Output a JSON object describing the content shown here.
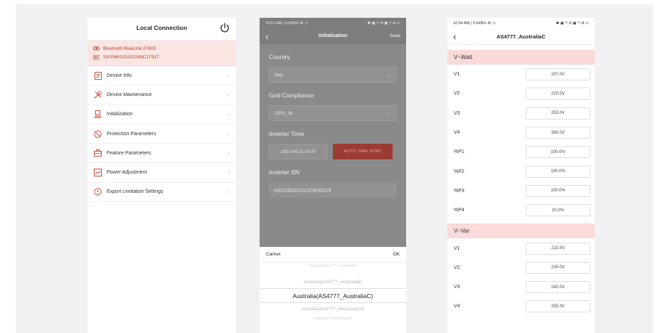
{
  "panel1": {
    "title": "Local Connection",
    "bluetooth": "Bluetooth:BlueLink:27805",
    "sn": "SN:R6K2153J2248C17917",
    "menu": [
      {
        "label": "Device Info",
        "icon": "device-info-icon"
      },
      {
        "label": "Device Maintenance",
        "icon": "maintenance-icon"
      },
      {
        "label": "Initialization",
        "icon": "initialization-icon"
      },
      {
        "label": "Protection Parameters",
        "icon": "protection-icon"
      },
      {
        "label": "Feature Parameters",
        "icon": "feature-icon"
      },
      {
        "label": "Power Adjustment",
        "icon": "power-adjust-icon"
      },
      {
        "label": "Export Limitation Settings",
        "icon": "export-limit-icon"
      }
    ]
  },
  "panel2": {
    "status_left": "10:51 AM | 0.0KB/s ⚙ ☺",
    "status_right": "✱ ▣ ᵛᵒ.ıll ▣ ᵛᵒ.ıll ▭",
    "title": "Initialization",
    "save": "Save",
    "country_label": "Country",
    "country_value": "Italy",
    "grid_label": "Grid Compliance",
    "grid_value": "CEI0_16",
    "time_label": "Inverter Time",
    "time_value": "2023-04-21 10:47",
    "sync_label": "AUTO TIME SYNC",
    "sn_label": "Inverter SN",
    "sn_value": "HSS2602G2237E00019",
    "cancel": "Cancel",
    "ok": "OK",
    "picker": {
      "top_faint": "Australia(AS4777_AustraliaA)",
      "above": "Australia(AS4777_AustraliaB)",
      "selected": "Australia(AS4777_AustraliaC)",
      "below": "Australia(AS4777_NewZealand)",
      "bottom_faint": "Australia(TOR Erzeuger)"
    }
  },
  "panel3": {
    "status_left": "10:54 AM | 0.5KB/s ⚙ ☺",
    "status_right": "✱ ▣ ᵛᵒ.ıll ▣ ᵛᵒ.ıll ▭",
    "title": "AS4777_AustraliaC",
    "sections": [
      {
        "name": "V~Watt",
        "rows": [
          {
            "label": "V1",
            "value": "207.0V"
          },
          {
            "label": "V2",
            "value": "220.0V"
          },
          {
            "label": "V3",
            "value": "253.0V"
          },
          {
            "label": "V4",
            "value": "260.0V"
          },
          {
            "label": "%P1",
            "value": "100.0%"
          },
          {
            "label": "%P2",
            "value": "100.0%"
          },
          {
            "label": "%P3",
            "value": "100.0%"
          },
          {
            "label": "%P4",
            "value": "20.0%"
          }
        ]
      },
      {
        "name": "V~Var",
        "rows": [
          {
            "label": "V1",
            "value": "215.0V"
          },
          {
            "label": "V2",
            "value": "230.0V"
          },
          {
            "label": "V3",
            "value": "240.0V"
          },
          {
            "label": "V4",
            "value": "255.0V"
          }
        ]
      }
    ]
  },
  "colors": {
    "accent_red": "#c0392b",
    "section_pink": "#fbdada",
    "sync_button": "#9b3a36"
  }
}
